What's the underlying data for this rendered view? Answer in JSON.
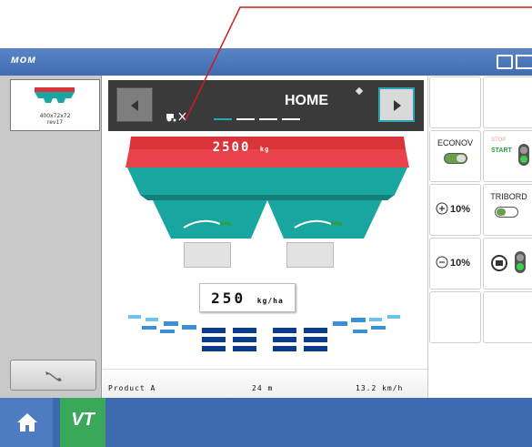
{
  "app": {
    "brand": "ᴍᴏᴍ"
  },
  "machine_tile": {
    "model": "400x72x72",
    "sub": "rev17",
    "icon": "spreader-hopper-icon"
  },
  "nav": {
    "title": "HOME",
    "prev_icon": "arrow-left-icon",
    "next_icon": "arrow-right-icon",
    "active_page": 1,
    "page_count": 4
  },
  "hopper": {
    "weight_value": "2500",
    "weight_unit": "kg"
  },
  "rate": {
    "value": "250",
    "unit": "kg/ha"
  },
  "status": {
    "product": "Product A",
    "width": "24 m",
    "speed": "13.2 km/h"
  },
  "buttons": {
    "econov": "ECONOV",
    "start_stop_top": "STOP",
    "start": "START",
    "triboro": "TRIBORD",
    "plus_pct": "10%",
    "minus_pct": "10%"
  },
  "taskbar": {
    "home_icon": "home-icon",
    "vt_label": "VT"
  },
  "colors": {
    "accent": "#2aa7b3",
    "hopper_red": "#d9343a",
    "hopper_teal": "#1aa6a0",
    "header_blue": "#4a78bd",
    "vt_green": "#3aa85a"
  }
}
